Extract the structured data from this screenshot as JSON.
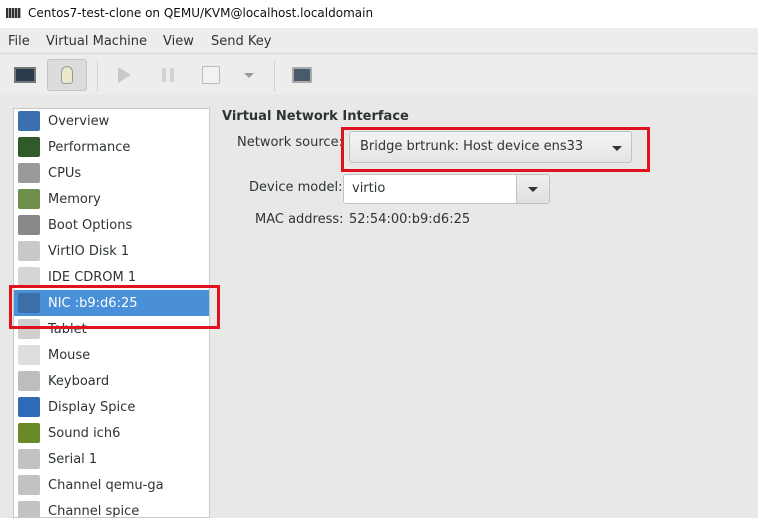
{
  "window": {
    "title": "Centos7-test-clone on QEMU/KVM@localhost.localdomain"
  },
  "menu": [
    "File",
    "Virtual Machine",
    "View",
    "Send Key"
  ],
  "toolbar": [
    "console-icon",
    "details-lightbulb-icon",
    "run-icon",
    "pause-icon",
    "shutdown-icon",
    "shutdown-menu-icon",
    "fullscreen-icon"
  ],
  "sidebar": {
    "items": [
      {
        "label": "Overview",
        "icon": "monitor-icon",
        "color": "#3a6fb0"
      },
      {
        "label": "Performance",
        "icon": "performance-graph-icon",
        "color": "#2f5a2a"
      },
      {
        "label": "CPUs",
        "icon": "cpu-chip-icon",
        "color": "#9a9a9a"
      },
      {
        "label": "Memory",
        "icon": "memory-icon",
        "color": "#6e8f4a"
      },
      {
        "label": "Boot Options",
        "icon": "gears-icon",
        "color": "#888888"
      },
      {
        "label": "VirtIO Disk 1",
        "icon": "hard-disk-icon",
        "color": "#c9c9c9"
      },
      {
        "label": "IDE CDROM 1",
        "icon": "cdrom-icon",
        "color": "#d5d5d5"
      },
      {
        "label": "NIC :b9:d6:25",
        "icon": "network-icon",
        "color": "#3d6ea8",
        "selected": true
      },
      {
        "label": "Tablet",
        "icon": "tablet-icon",
        "color": "#cfcfcf"
      },
      {
        "label": "Mouse",
        "icon": "mouse-icon",
        "color": "#dedede"
      },
      {
        "label": "Keyboard",
        "icon": "keyboard-icon",
        "color": "#bdbdbd"
      },
      {
        "label": "Display Spice",
        "icon": "display-icon",
        "color": "#2f6bb8"
      },
      {
        "label": "Sound ich6",
        "icon": "sound-card-icon",
        "color": "#6a8a2a"
      },
      {
        "label": "Serial 1",
        "icon": "serial-icon",
        "color": "#c2c2c2"
      },
      {
        "label": "Channel qemu-ga",
        "icon": "channel-icon",
        "color": "#c2c2c2"
      },
      {
        "label": "Channel spice",
        "icon": "channel-icon",
        "color": "#c2c2c2"
      }
    ]
  },
  "main": {
    "heading": "Virtual Network Interface",
    "network_source_label": "Network source:",
    "network_source_value": "Bridge brtrunk: Host device ens33",
    "device_model_label": "Device model:",
    "device_model_value": "virtio",
    "mac_label": "MAC address:",
    "mac_value": "52:54:00:b9:d6:25"
  },
  "highlight_color": "#e0121f",
  "selection_color": "#4a90d9"
}
